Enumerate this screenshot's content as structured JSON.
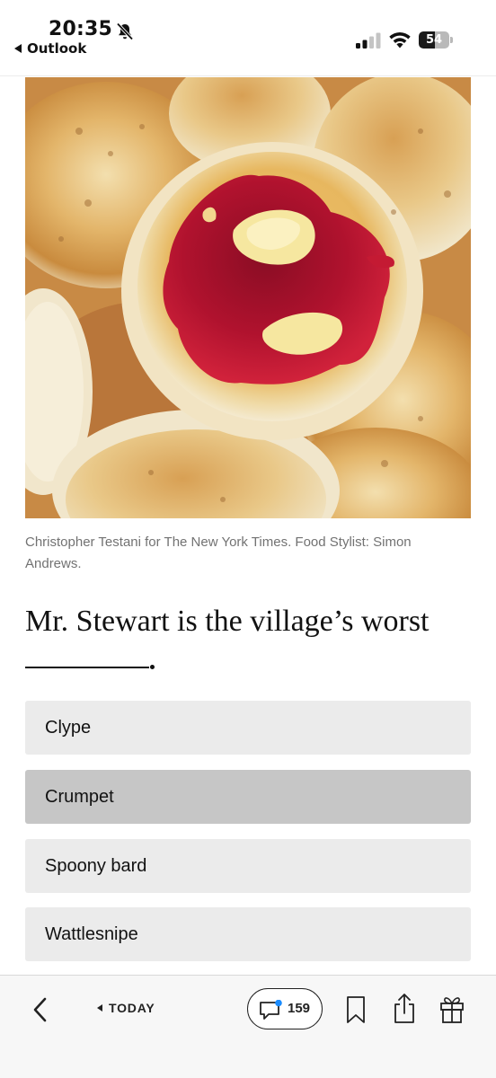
{
  "status_bar": {
    "time": "20:35",
    "back_app": "Outlook",
    "battery_level": "54",
    "battery_fraction": 0.54,
    "bell_icon": "bell-slash-icon",
    "signal_icon": "cellular-signal-icon",
    "wifi_icon": "wifi-icon"
  },
  "article": {
    "photo_caption": "Christopher Testani for The New York Times. Food Stylist: Simon Andrews.",
    "question": "Mr. Stewart is the village’s worst"
  },
  "quiz": {
    "options": [
      {
        "label": "Clype",
        "selected": false
      },
      {
        "label": "Crumpet",
        "selected": true
      },
      {
        "label": "Spoony bard",
        "selected": false
      },
      {
        "label": "Wattlesnipe",
        "selected": false
      }
    ]
  },
  "toolbar": {
    "today_label": "TODAY",
    "comment_count": "159",
    "icons": [
      "back-chevron-icon",
      "comment-bubble-icon",
      "bookmark-icon",
      "share-icon",
      "gift-icon"
    ]
  },
  "colors": {
    "option_bg": "#ebebeb",
    "option_selected_bg": "#c6c6c6",
    "notification_dot": "#1a8cff"
  }
}
